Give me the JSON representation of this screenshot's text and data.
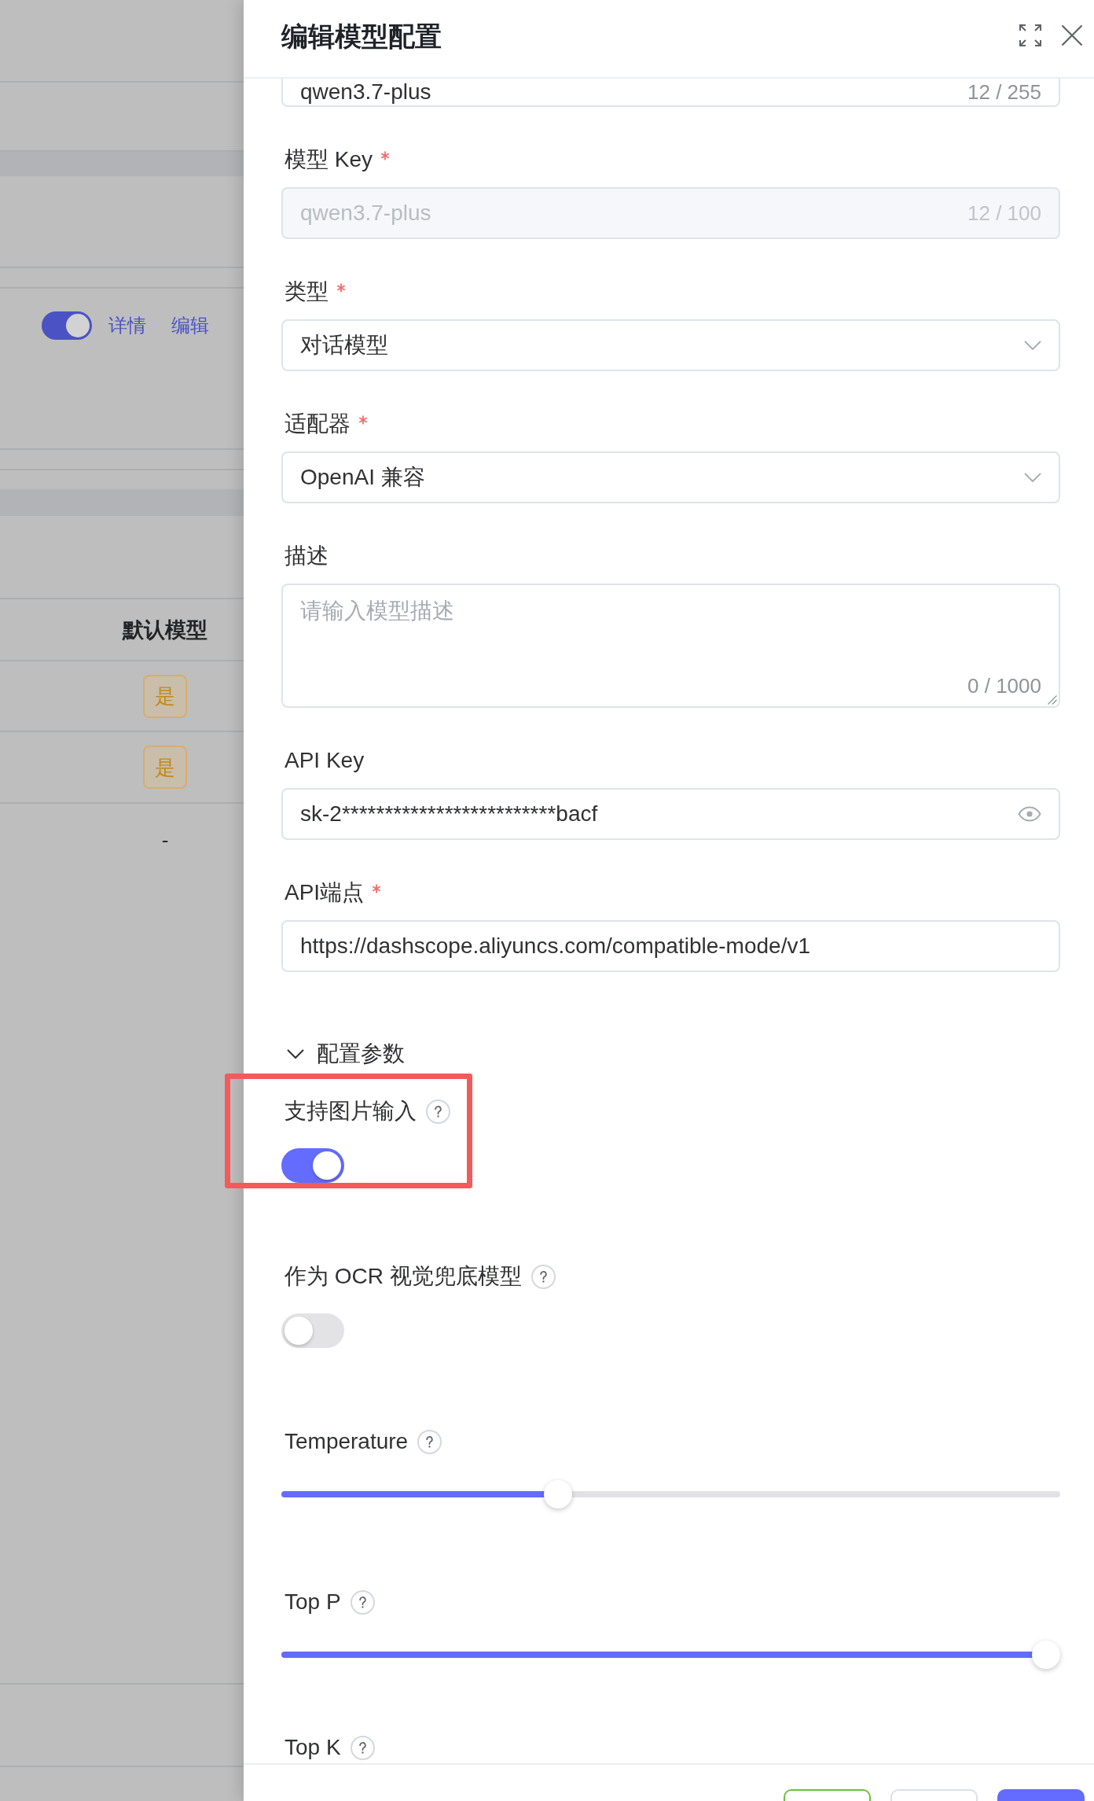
{
  "backdrop": {
    "row_toggle": {
      "on": true
    },
    "row_links": [
      "详情",
      "编辑"
    ],
    "column_header": "默认模型",
    "column_cells": [
      {
        "kind": "tag",
        "text": "是"
      },
      {
        "kind": "tag",
        "text": "是"
      },
      {
        "kind": "text",
        "text": "-"
      }
    ]
  },
  "drawer": {
    "title": "编辑模型配置",
    "field_above": {
      "value": "qwen3.7-plus",
      "counter": "12 / 255"
    },
    "fields": [
      {
        "kind": "input",
        "label": "模型 Key",
        "required": true,
        "disabled": true,
        "value": "qwen3.7-plus",
        "counter": "12 / 100"
      },
      {
        "kind": "select",
        "label": "类型",
        "required": true,
        "disabled": false,
        "value": "对话模型"
      },
      {
        "kind": "select",
        "label": "适配器",
        "required": true,
        "disabled": false,
        "value": "OpenAI 兼容"
      },
      {
        "kind": "textarea",
        "label": "描述",
        "required": false,
        "disabled": false,
        "placeholder": "请输入模型描述",
        "counter": "0 / 1000"
      },
      {
        "kind": "password",
        "label": "API Key",
        "required": false,
        "disabled": false,
        "value": "sk-2*************************bacf"
      },
      {
        "kind": "input",
        "label": "API端点",
        "required": true,
        "disabled": false,
        "value": "https://dashscope.aliyuncs.com/compatible-mode/v1"
      }
    ],
    "section": {
      "label": "配置参数",
      "expanded": true
    },
    "params": [
      {
        "kind": "toggle",
        "label": "支持图片输入",
        "on": true,
        "highlighted": true
      },
      {
        "kind": "toggle",
        "label": "作为 OCR 视觉兜底模型",
        "on": false,
        "highlighted": false
      },
      {
        "kind": "slider",
        "label": "Temperature",
        "level": 0.35,
        "highlighted": false
      },
      {
        "kind": "slider",
        "label": "Top P",
        "level": 1,
        "highlighted": false
      },
      {
        "kind": "heading",
        "label": "Top K",
        "highlighted": false
      }
    ],
    "footer_buttons": [
      {
        "kind": "success"
      },
      {
        "kind": "default"
      },
      {
        "kind": "primary"
      }
    ]
  }
}
